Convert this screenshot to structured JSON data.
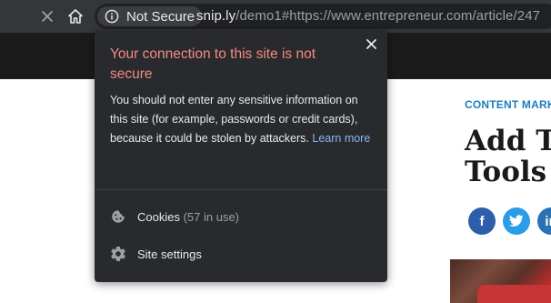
{
  "browser": {
    "security_label": "Not Secure",
    "url_domain": "snip.ly",
    "url_rest": "/demo1#https://www.entrepreneur.com/article/247"
  },
  "popup": {
    "title": "Your connection to this site is not secure",
    "description": "You should not enter any sensitive information on this site (for example, passwords or credit cards), because it could be stolen by attackers.",
    "learn_more": "Learn more",
    "cookies_label": "Cookies",
    "cookies_count": "(57 in use)",
    "site_settings_label": "Site settings"
  },
  "page": {
    "category": "CONTENT MARK",
    "headline_line1": "Add Th",
    "headline_line2": "Tools t",
    "social": {
      "facebook": "f",
      "twitter": "t",
      "linkedin": "in"
    }
  }
}
